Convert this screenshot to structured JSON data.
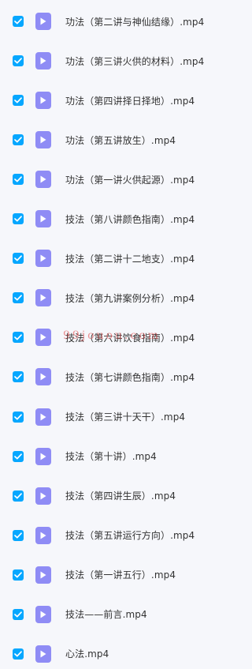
{
  "colors": {
    "checkbox": "#06a7ff",
    "file_icon": "#8f8cf5",
    "background": "#f6f7fb",
    "text": "#333333"
  },
  "files": [
    {
      "name": "功法（第二讲与神仙结缘）.mp4",
      "checked": true,
      "icon": "video-file-icon"
    },
    {
      "name": "功法（第三讲火供的材料）.mp4",
      "checked": true,
      "icon": "video-file-icon"
    },
    {
      "name": "功法（第四讲择日择地）.mp4",
      "checked": true,
      "icon": "video-file-icon"
    },
    {
      "name": "功法（第五讲放生）.mp4",
      "checked": true,
      "icon": "video-file-icon"
    },
    {
      "name": "功法（第一讲火供起源）.mp4",
      "checked": true,
      "icon": "video-file-icon"
    },
    {
      "name": "技法（第八讲颜色指南）.mp4",
      "checked": true,
      "icon": "video-file-icon"
    },
    {
      "name": "技法（第二讲十二地支）.mp4",
      "checked": true,
      "icon": "video-file-icon"
    },
    {
      "name": "技法（第九讲案例分析）.mp4",
      "checked": true,
      "icon": "video-file-icon"
    },
    {
      "name": "技法（第六讲饮食指南）.mp4",
      "checked": true,
      "icon": "video-file-icon"
    },
    {
      "name": "技法（第七讲颜色指南）.mp4",
      "checked": true,
      "icon": "video-file-icon"
    },
    {
      "name": "技法（第三讲十天干）.mp4",
      "checked": true,
      "icon": "video-file-icon"
    },
    {
      "name": "技法（第十讲）.mp4",
      "checked": true,
      "icon": "video-file-icon"
    },
    {
      "name": "技法（第四讲生辰）.mp4",
      "checked": true,
      "icon": "video-file-icon"
    },
    {
      "name": "技法（第五讲运行方向）.mp4",
      "checked": true,
      "icon": "video-file-icon"
    },
    {
      "name": "技法（第一讲五行）.mp4",
      "checked": true,
      "icon": "video-file-icon"
    },
    {
      "name": "技法——前言.mp4",
      "checked": true,
      "icon": "video-file-icon"
    },
    {
      "name": "心法.mp4",
      "checked": true,
      "icon": "video-file-icon"
    }
  ],
  "watermark": "99jouou.com"
}
